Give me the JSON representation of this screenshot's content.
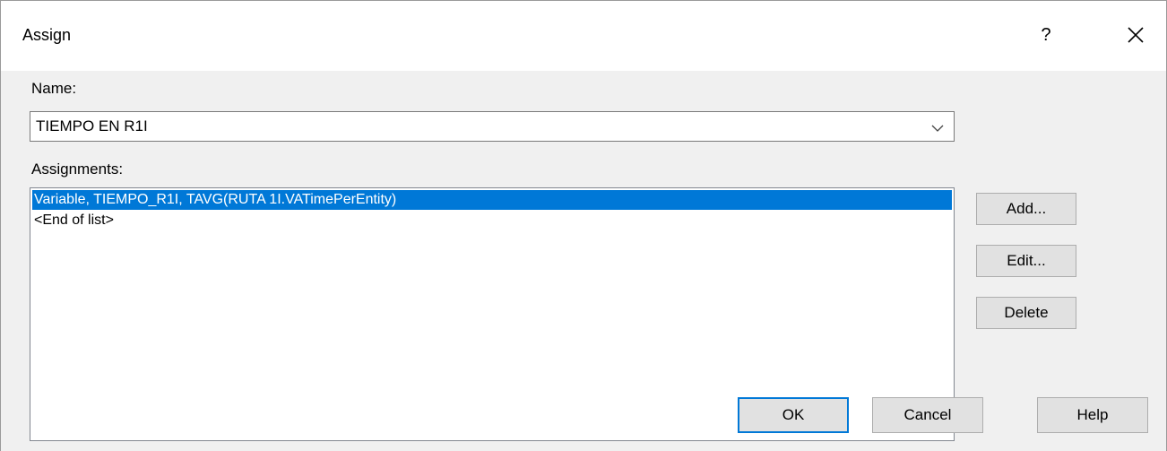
{
  "window": {
    "title": "Assign",
    "help_button": "?",
    "close_button": "×"
  },
  "name_field": {
    "label": "Name:",
    "value": "TIEMPO EN R1I"
  },
  "assignments": {
    "label": "Assignments:",
    "items": [
      {
        "text": "Variable, TIEMPO_R1I, TAVG(RUTA 1I.VATimePerEntity)",
        "selected": true
      },
      {
        "text": "<End of list>",
        "selected": false
      }
    ]
  },
  "side_buttons": {
    "add": "Add...",
    "edit": "Edit...",
    "delete": "Delete"
  },
  "footer_buttons": {
    "ok": "OK",
    "cancel": "Cancel",
    "help": "Help"
  },
  "colors": {
    "selection": "#0078d7",
    "default_button_border": "#0078d7",
    "dialog_background": "#f0f0f0"
  }
}
